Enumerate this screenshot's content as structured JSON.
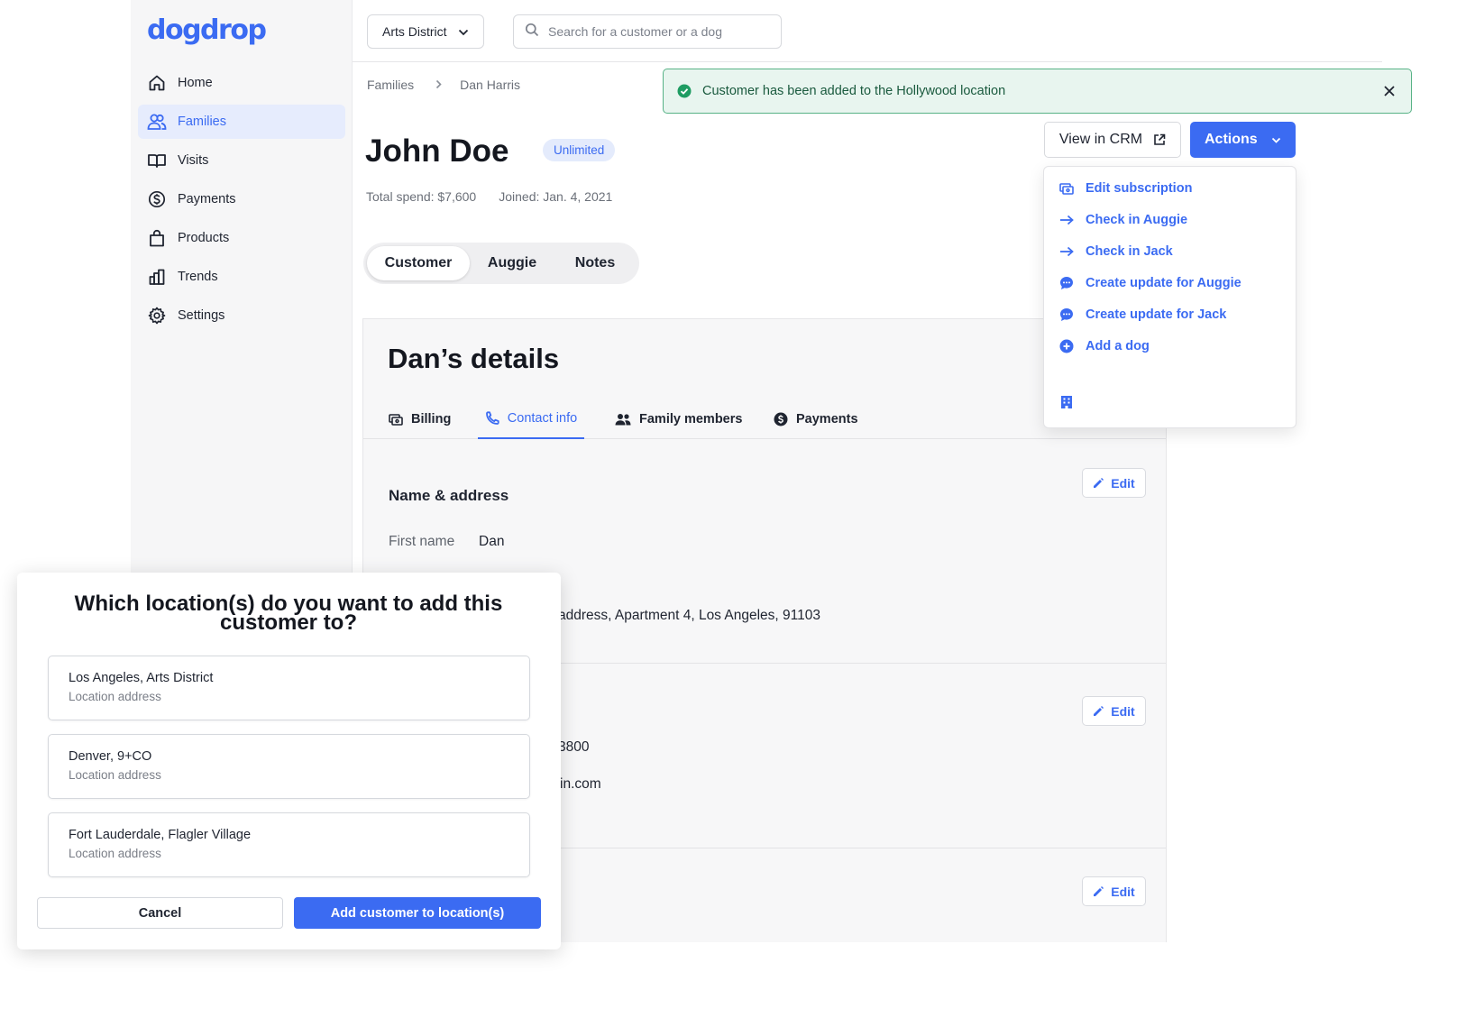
{
  "colors": {
    "accent": "#3b6bf2",
    "success": "#1e9c62",
    "success_bg": "#e8f5ef"
  },
  "app": {
    "logo": "dogdrop"
  },
  "sidebar": {
    "items": [
      {
        "label": "Home",
        "icon": "home-icon"
      },
      {
        "label": "Families",
        "icon": "users-icon",
        "active": true
      },
      {
        "label": "Visits",
        "icon": "book-icon"
      },
      {
        "label": "Payments",
        "icon": "dollar-circle-icon"
      },
      {
        "label": "Products",
        "icon": "bag-icon"
      },
      {
        "label": "Trends",
        "icon": "bar-chart-icon"
      },
      {
        "label": "Settings",
        "icon": "gear-icon"
      }
    ]
  },
  "topbar": {
    "location": "Arts District",
    "search_placeholder": "Search for a customer or a dog"
  },
  "breadcrumb": {
    "parent": "Families",
    "current": "Dan Harris"
  },
  "customer": {
    "name": "John Doe",
    "plan": "Unlimited",
    "total_spend": "Total spend: $7,600",
    "joined": "Joined: Jan. 4, 2021"
  },
  "segment_tabs": [
    {
      "label": "Customer",
      "active": true
    },
    {
      "label": "Auggie"
    },
    {
      "label": "Notes"
    }
  ],
  "details": {
    "title": "Dan’s details",
    "tabs": [
      {
        "label": "Billing",
        "icon": "billing-icon"
      },
      {
        "label": "Contact info",
        "icon": "phone-icon",
        "active": true
      },
      {
        "label": "Family members",
        "icon": "people-icon"
      },
      {
        "label": "Payments",
        "icon": "dollar-circle-icon"
      }
    ],
    "section_title": "Name & address",
    "first_name_label": "First name",
    "first_name_value": "Dan",
    "address_partial": "address, Apartment 4, Los Angeles, 91103",
    "phone_partial": "3800",
    "email_partial": "in.com",
    "edit_label": "Edit"
  },
  "header_actions": {
    "crm_label": "View in CRM",
    "actions_label": "Actions"
  },
  "actions_menu": {
    "items": [
      {
        "label": "Edit subscription",
        "icon": "subscription-icon"
      },
      {
        "label": "Check in Auggie",
        "icon": "arrow-right-icon"
      },
      {
        "label": "Check in Jack",
        "icon": "arrow-right-icon"
      },
      {
        "label": "Create update for Auggie",
        "icon": "chat-bubble-icon"
      },
      {
        "label": "Create update for Jack",
        "icon": "chat-bubble-icon"
      },
      {
        "label": "Add a dog",
        "icon": "plus-circle-icon"
      }
    ],
    "footer_icon": "building-icon"
  },
  "toast": {
    "message": "Customer has been added to the Hollywood location"
  },
  "modal": {
    "title": "Which location(s) do you want to add this customer to?",
    "locations": [
      {
        "name": "Los Angeles, Arts District",
        "address": "Location address"
      },
      {
        "name": "Denver, 9+CO",
        "address": "Location address"
      },
      {
        "name": "Fort Lauderdale, Flagler Village",
        "address": "Location address"
      }
    ],
    "cancel_label": "Cancel",
    "confirm_label": "Add customer to location(s)"
  }
}
